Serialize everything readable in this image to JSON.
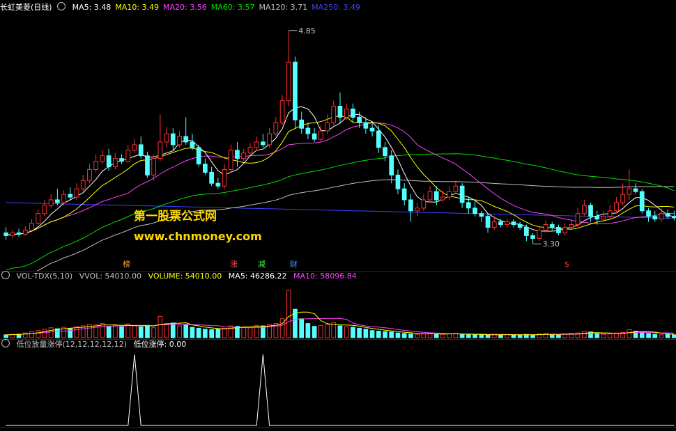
{
  "main_panel": {
    "title": "长虹美菱(日线)",
    "ma": [
      {
        "label": "MA5: 3.48",
        "color": "#ffffff"
      },
      {
        "label": "MA10: 3.49",
        "color": "#ffff00"
      },
      {
        "label": "MA20: 3.56",
        "color": "#ff40ff"
      },
      {
        "label": "MA60: 3.57",
        "color": "#00e000"
      },
      {
        "label": "MA120: 3.71",
        "color": "#c0c0c0"
      },
      {
        "label": "MA250: 3.49",
        "color": "#4040ff"
      }
    ],
    "high_label": "4.85",
    "low_label": "3.30",
    "tags": [
      {
        "text": "榜",
        "color": "#ffa040"
      },
      {
        "text": "涨",
        "color": "#ff5050"
      },
      {
        "text": "减",
        "color": "#40ff40"
      },
      {
        "text": "财",
        "color": "#40a0ff"
      },
      {
        "text": "$",
        "color": "#ff3030"
      }
    ]
  },
  "watermark": {
    "line1": "第一股票公式网",
    "line2": "www.chnmoney.com"
  },
  "volume_panel": {
    "name": "VOL-TDX(5,10)",
    "vvol": "VVOL: 54010.00",
    "volume": "VOLUME: 54010.00",
    "ma5": "MA5: 46286.22",
    "ma10": "MA10: 58096.84"
  },
  "indicator_panel": {
    "name": "低位放量涨停(12,12,12,12,12)",
    "value": "低位涨停: 0.00"
  },
  "colors": {
    "up": "#ff3232",
    "down": "#54ffff",
    "ma5": "#ffffff",
    "ma10": "#ffff00",
    "ma20": "#ff40ff",
    "ma60": "#00e000",
    "ma120": "#c0c0c0",
    "ma250": "#4040ff"
  },
  "chart_data": {
    "type": "candlestick",
    "y_range": [
      3.2,
      4.95
    ],
    "candles": [
      [
        3.38,
        3.36,
        3.42,
        3.33
      ],
      [
        3.36,
        3.38,
        3.4,
        3.34
      ],
      [
        3.38,
        3.37,
        3.41,
        3.35
      ],
      [
        3.37,
        3.4,
        3.43,
        3.36
      ],
      [
        3.4,
        3.45,
        3.48,
        3.39
      ],
      [
        3.45,
        3.52,
        3.55,
        3.44
      ],
      [
        3.52,
        3.58,
        3.62,
        3.5
      ],
      [
        3.58,
        3.62,
        3.66,
        3.56
      ],
      [
        3.62,
        3.6,
        3.7,
        3.58
      ],
      [
        3.6,
        3.66,
        3.69,
        3.58
      ],
      [
        3.66,
        3.64,
        3.71,
        3.62
      ],
      [
        3.64,
        3.7,
        3.74,
        3.62
      ],
      [
        3.7,
        3.76,
        3.8,
        3.68
      ],
      [
        3.76,
        3.84,
        3.88,
        3.74
      ],
      [
        3.84,
        3.9,
        3.95,
        3.82
      ],
      [
        3.9,
        3.94,
        3.98,
        3.88
      ],
      [
        3.94,
        3.86,
        3.99,
        3.83
      ],
      [
        3.86,
        3.92,
        3.96,
        3.84
      ],
      [
        3.92,
        3.9,
        3.95,
        3.88
      ],
      [
        3.9,
        3.98,
        4.02,
        3.89
      ],
      [
        3.98,
        4.02,
        4.06,
        3.96
      ],
      [
        4.02,
        3.94,
        4.08,
        3.92
      ],
      [
        3.94,
        3.8,
        3.97,
        3.78
      ],
      [
        3.8,
        3.92,
        3.95,
        3.76
      ],
      [
        3.92,
        4.04,
        4.24,
        3.9
      ],
      [
        4.04,
        4.1,
        4.15,
        4.0
      ],
      [
        4.1,
        4.02,
        4.14,
        3.98
      ],
      [
        4.02,
        4.08,
        4.12,
        4.0
      ],
      [
        4.08,
        4.04,
        4.22,
        4.02
      ],
      [
        4.04,
        4.0,
        4.1,
        3.98
      ],
      [
        4.0,
        3.88,
        4.02,
        3.86
      ],
      [
        3.88,
        3.82,
        3.92,
        3.8
      ],
      [
        3.82,
        3.74,
        3.86,
        3.72
      ],
      [
        3.74,
        3.72,
        3.78,
        3.7
      ],
      [
        3.72,
        3.84,
        3.88,
        3.7
      ],
      [
        3.84,
        3.98,
        4.02,
        3.82
      ],
      [
        3.98,
        3.92,
        4.04,
        3.86
      ],
      [
        3.92,
        3.96,
        3.99,
        3.9
      ],
      [
        3.96,
        4.0,
        4.03,
        3.94
      ],
      [
        4.0,
        4.04,
        4.08,
        3.98
      ],
      [
        4.04,
        4.02,
        4.1,
        4.0
      ],
      [
        4.02,
        4.1,
        4.14,
        4.0
      ],
      [
        4.1,
        4.18,
        4.22,
        4.08
      ],
      [
        4.18,
        4.34,
        4.38,
        4.16
      ],
      [
        4.34,
        4.62,
        4.85,
        4.3
      ],
      [
        4.62,
        4.2,
        4.66,
        4.14
      ],
      [
        4.2,
        4.14,
        4.26,
        4.1
      ],
      [
        4.14,
        4.1,
        4.18,
        4.06
      ],
      [
        4.1,
        4.06,
        4.14,
        4.04
      ],
      [
        4.06,
        4.12,
        4.16,
        4.04
      ],
      [
        4.12,
        4.18,
        4.24,
        4.1
      ],
      [
        4.18,
        4.3,
        4.34,
        4.16
      ],
      [
        4.3,
        4.22,
        4.4,
        4.18
      ],
      [
        4.22,
        4.28,
        4.32,
        4.2
      ],
      [
        4.28,
        4.22,
        4.32,
        4.18
      ],
      [
        4.22,
        4.18,
        4.26,
        4.14
      ],
      [
        4.18,
        4.14,
        4.22,
        4.1
      ],
      [
        4.14,
        4.12,
        4.18,
        4.08
      ],
      [
        4.12,
        4.0,
        4.16,
        3.96
      ],
      [
        4.0,
        3.94,
        4.04,
        3.9
      ],
      [
        3.94,
        3.8,
        3.98,
        3.74
      ],
      [
        3.8,
        3.7,
        3.84,
        3.66
      ],
      [
        3.7,
        3.62,
        3.74,
        3.58
      ],
      [
        3.62,
        3.54,
        3.66,
        3.46
      ],
      [
        3.54,
        3.56,
        3.6,
        3.5
      ],
      [
        3.56,
        3.62,
        3.66,
        3.54
      ],
      [
        3.62,
        3.68,
        3.72,
        3.6
      ],
      [
        3.68,
        3.62,
        3.72,
        3.58
      ],
      [
        3.62,
        3.64,
        3.68,
        3.6
      ],
      [
        3.64,
        3.68,
        3.72,
        3.62
      ],
      [
        3.68,
        3.72,
        3.76,
        3.66
      ],
      [
        3.72,
        3.6,
        3.74,
        3.56
      ],
      [
        3.6,
        3.56,
        3.64,
        3.52
      ],
      [
        3.56,
        3.52,
        3.62,
        3.5
      ],
      [
        3.52,
        3.5,
        3.54,
        3.46
      ],
      [
        3.5,
        3.42,
        3.52,
        3.38
      ],
      [
        3.42,
        3.46,
        3.5,
        3.4
      ],
      [
        3.46,
        3.44,
        3.48,
        3.42
      ],
      [
        3.44,
        3.46,
        3.48,
        3.42
      ],
      [
        3.46,
        3.44,
        3.48,
        3.42
      ],
      [
        3.44,
        3.42,
        3.46,
        3.4
      ],
      [
        3.42,
        3.36,
        3.44,
        3.32
      ],
      [
        3.36,
        3.34,
        3.38,
        3.3
      ],
      [
        3.34,
        3.4,
        3.43,
        3.32
      ],
      [
        3.4,
        3.44,
        3.47,
        3.38
      ],
      [
        3.44,
        3.42,
        3.46,
        3.4
      ],
      [
        3.42,
        3.38,
        3.44,
        3.36
      ],
      [
        3.38,
        3.42,
        3.45,
        3.36
      ],
      [
        3.42,
        3.44,
        3.48,
        3.4
      ],
      [
        3.44,
        3.52,
        3.56,
        3.42
      ],
      [
        3.52,
        3.58,
        3.62,
        3.5
      ],
      [
        3.58,
        3.5,
        3.6,
        3.46
      ],
      [
        3.5,
        3.48,
        3.54,
        3.44
      ],
      [
        3.48,
        3.5,
        3.54,
        3.46
      ],
      [
        3.5,
        3.54,
        3.58,
        3.48
      ],
      [
        3.54,
        3.6,
        3.64,
        3.52
      ],
      [
        3.6,
        3.66,
        3.74,
        3.58
      ],
      [
        3.66,
        3.7,
        3.84,
        3.62
      ],
      [
        3.7,
        3.68,
        3.74,
        3.66
      ],
      [
        3.68,
        3.54,
        3.7,
        3.52
      ],
      [
        3.54,
        3.5,
        3.56,
        3.46
      ],
      [
        3.5,
        3.48,
        3.54,
        3.46
      ],
      [
        3.48,
        3.52,
        3.56,
        3.46
      ],
      [
        3.52,
        3.5,
        3.55,
        3.48
      ],
      [
        3.5,
        3.49,
        3.54,
        3.47
      ]
    ],
    "volume": {
      "range": [
        0,
        200000
      ],
      "values": [
        12000,
        14000,
        15000,
        20000,
        26000,
        30000,
        36000,
        42000,
        38000,
        44000,
        40000,
        48000,
        50000,
        56000,
        54000,
        60000,
        48000,
        52000,
        46000,
        58000,
        50000,
        46000,
        52000,
        42000,
        90000,
        60000,
        62000,
        50000,
        54000,
        44000,
        40000,
        36000,
        34000,
        38000,
        40000,
        50000,
        48000,
        46000,
        44000,
        52000,
        50000,
        56000,
        60000,
        80000,
        200000,
        120000,
        80000,
        60000,
        48000,
        52000,
        56000,
        64000,
        50000,
        46000,
        44000,
        40000,
        36000,
        30000,
        28000,
        26000,
        24000,
        20000,
        18000,
        16000,
        14000,
        16000,
        18000,
        16000,
        14000,
        16000,
        18000,
        14000,
        12000,
        12000,
        13000,
        12000,
        14000,
        12000,
        13000,
        12000,
        11000,
        14000,
        12000,
        16000,
        18000,
        14000,
        12000,
        16000,
        18000,
        20000,
        26000,
        24000,
        18000,
        14000,
        16000,
        20000,
        22000,
        34000,
        28000,
        24000,
        18000,
        14000,
        12000,
        14000,
        12000
      ]
    },
    "indicator": {
      "name": "低位涨停",
      "spikes_at": [
        20,
        40
      ],
      "range": [
        0,
        1
      ],
      "last": 0.0
    }
  }
}
